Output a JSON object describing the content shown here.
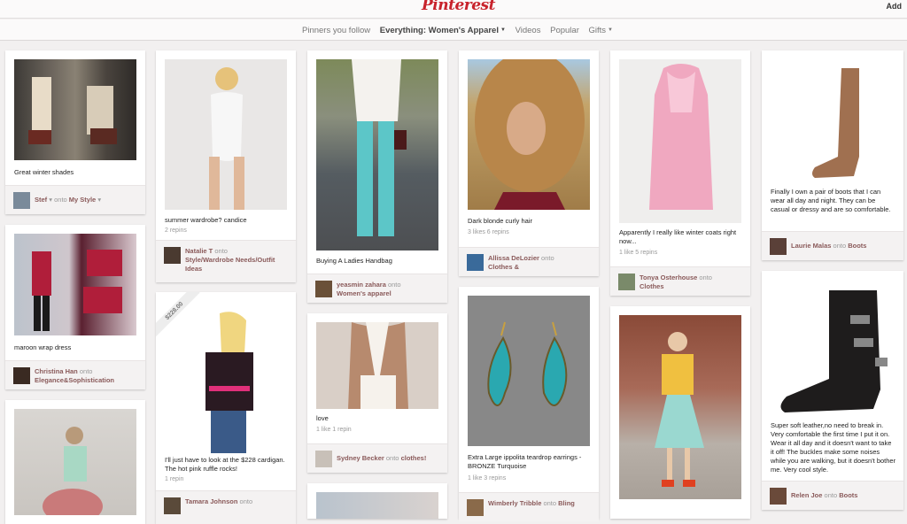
{
  "header": {
    "logo": "Pinterest",
    "add_label": "Add"
  },
  "nav": {
    "following": "Pinners you follow",
    "everything": "Everything: Women's Apparel",
    "videos": "Videos",
    "popular": "Popular",
    "gifts": "Gifts"
  },
  "pins": {
    "p1": {
      "desc": "Great winter shades",
      "user": "Stef",
      "board": "My Style"
    },
    "p2": {
      "desc": "maroon wrap dress",
      "user": "Christina Han",
      "board": "Elegance&Sophistication"
    },
    "p4": {
      "desc": "summer wardrobe? candice",
      "stats": "2 repins",
      "user": "Natalie T",
      "board": "Style/Wardrobe Needs/Outfit Ideas"
    },
    "p5": {
      "price": "$228.00",
      "desc": "I'll just have to look at the $228 cardigan. The hot pink ruffle rocks!",
      "stats": "1 repin",
      "user": "Tamara Johnson"
    },
    "p6": {
      "desc": "Buying A Ladies Handbag",
      "user": "yeasmin zahara",
      "board": "Women's apparel"
    },
    "p7": {
      "desc": "love",
      "stats": "1 like  1 repin",
      "user": "Sydney Becker",
      "board": "clothes!"
    },
    "p9": {
      "desc": "Dark blonde curly hair",
      "stats": "3 likes  6 repins",
      "user": "Allissa DeLozier",
      "board": "Clothes &"
    },
    "p10": {
      "desc": "Extra Large ippolita teardrop earrings - BRONZE Turquoise",
      "stats": "1 like  3 repins",
      "user": "Wimberly Tribble",
      "board": "Bling"
    },
    "p11": {
      "desc": "Apparently I really like winter coats right now...",
      "stats": "1 like  5 repins",
      "user": "Tonya Osterhouse",
      "board": "Clothes"
    },
    "p13": {
      "desc": "Finally I own a pair of boots that I can wear all day and night. They can be casual or dressy and are so comfortable.",
      "user": "Laurie Malas",
      "board": "Boots"
    },
    "p14": {
      "desc": "Super soft leather,no need to break in. Very comfortable the first time I put it on. Wear it all day and it doesn't want to take it off! The buckles make some noises while you are walking, but it doesn't bother me. Very cool style.",
      "user": "Relen Joe",
      "board": "Boots"
    }
  },
  "colors": {
    "brand": "#c8232c",
    "background": "#f2f0f0",
    "card": "#ffffff"
  }
}
